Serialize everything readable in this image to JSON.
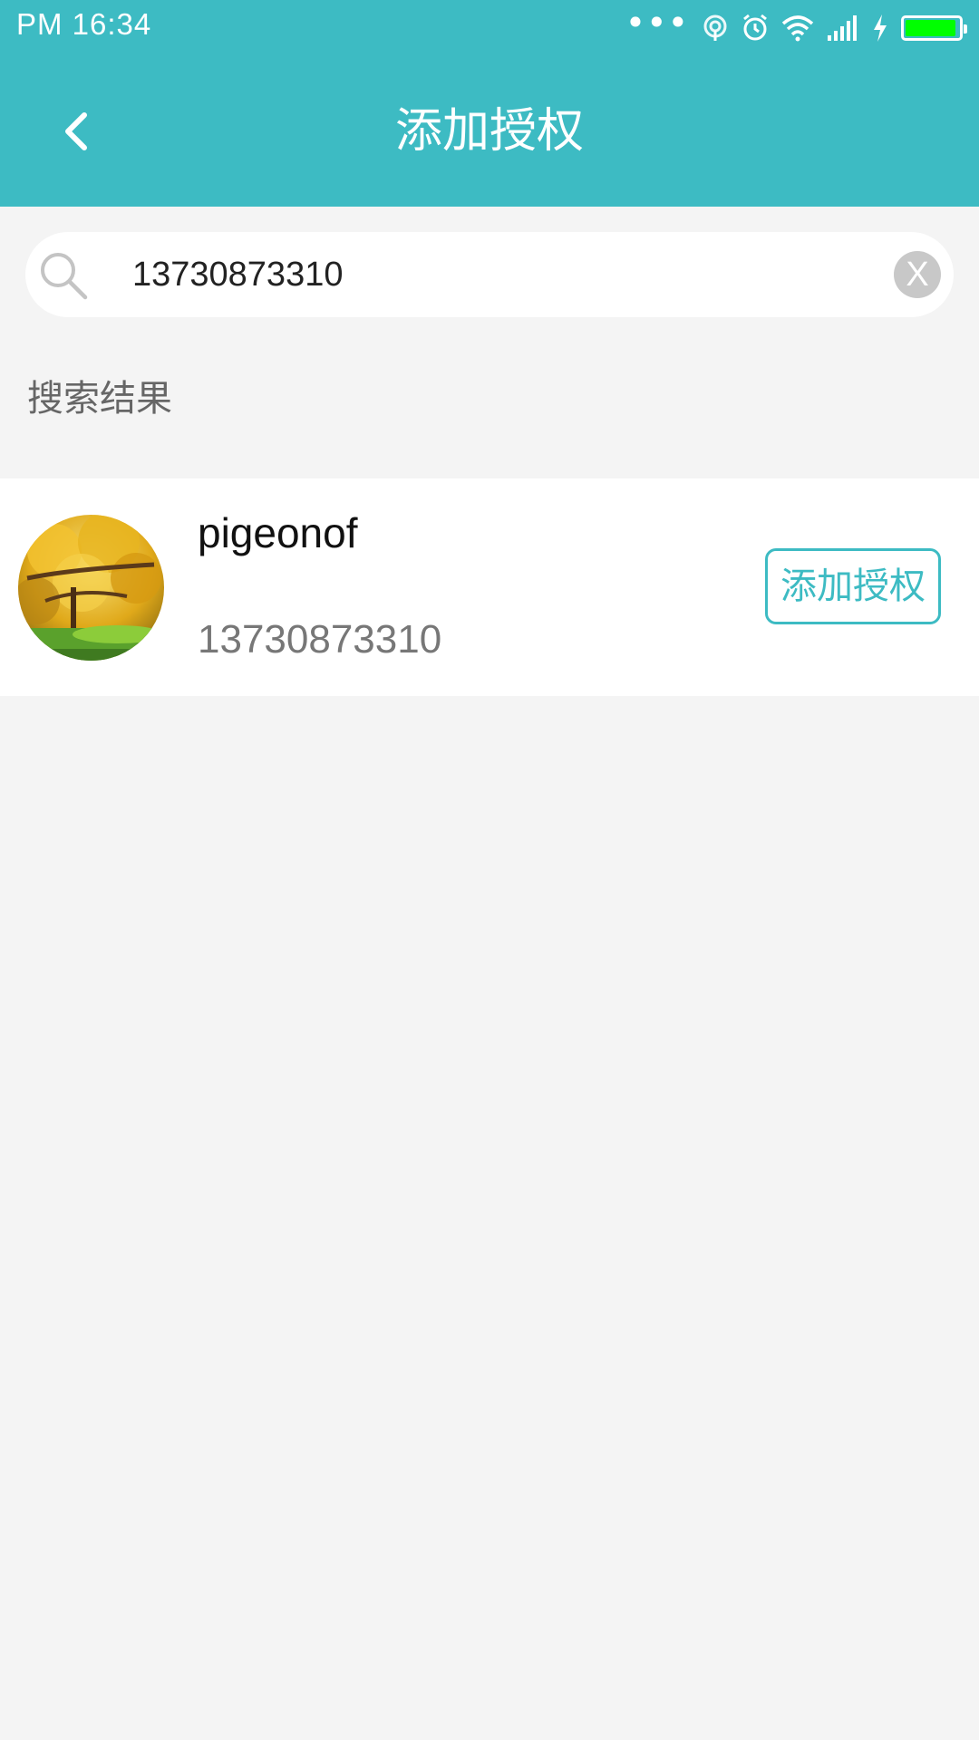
{
  "status_bar": {
    "time": "PM  16:34",
    "more_indicator": "•••",
    "battery_color": "#00ff00",
    "battery_level": 0.95,
    "icons": [
      "more-icon",
      "hotspot-icon",
      "alarm-icon",
      "wifi-icon",
      "signal-icon",
      "charging-icon",
      "battery-icon"
    ]
  },
  "header": {
    "title": "添加授权",
    "back_icon": "chevron-left-icon",
    "background_color": "#3dbbc3"
  },
  "search": {
    "value": "13730873310",
    "placeholder": "",
    "search_icon": "search-icon",
    "clear_label": "X"
  },
  "results": {
    "section_label": "搜索结果",
    "items": [
      {
        "name": "pigeonof",
        "phone": "13730873310",
        "action_label": "添加授权",
        "avatar": "avatar-autumn-tree-image"
      }
    ]
  },
  "colors": {
    "accent": "#3dbbc3",
    "page_background": "#f4f4f4",
    "secondary_text": "#777777"
  }
}
